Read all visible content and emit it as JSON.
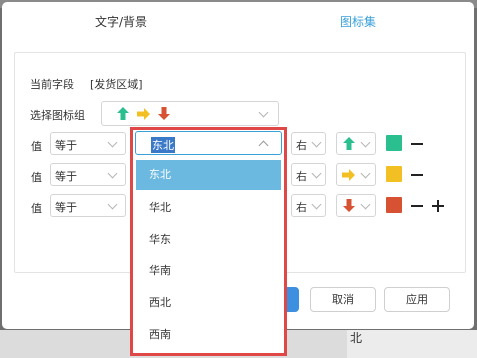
{
  "dialog": {
    "tabs": [
      {
        "label": "文字/背景",
        "active": false
      },
      {
        "label": "图标集",
        "active": true
      }
    ],
    "current_field_label": "当前字段",
    "current_field_value": "[发货区域]",
    "icon_group_label": "选择图标组",
    "icon_group_value": [
      "up-arrow-green",
      "right-arrow-yellow",
      "down-arrow-red"
    ],
    "rules": [
      {
        "label": "值",
        "operator": "等于",
        "value": "东北",
        "position": "右",
        "icon": "up-arrow-green",
        "color": "#2bbf8f"
      },
      {
        "label": "值",
        "operator": "等于",
        "value": "",
        "position": "右",
        "icon": "right-arrow-yellow",
        "color": "#f3c024"
      },
      {
        "label": "值",
        "operator": "等于",
        "value": "",
        "position": "右",
        "icon": "down-arrow-red",
        "color": "#d75133"
      }
    ],
    "buttons": {
      "cancel": "取消",
      "apply": "应用"
    }
  },
  "dropdown": {
    "selected": "东北",
    "options": [
      "东北",
      "华北",
      "华东",
      "华南",
      "西北",
      "西南"
    ]
  },
  "background": {
    "bottom_text": "北"
  },
  "colors": {
    "accent": "#3aa0d8",
    "selected_option": "#6bb8e0",
    "highlight_border": "#e04848",
    "primary_button": "#3d8fe0"
  }
}
